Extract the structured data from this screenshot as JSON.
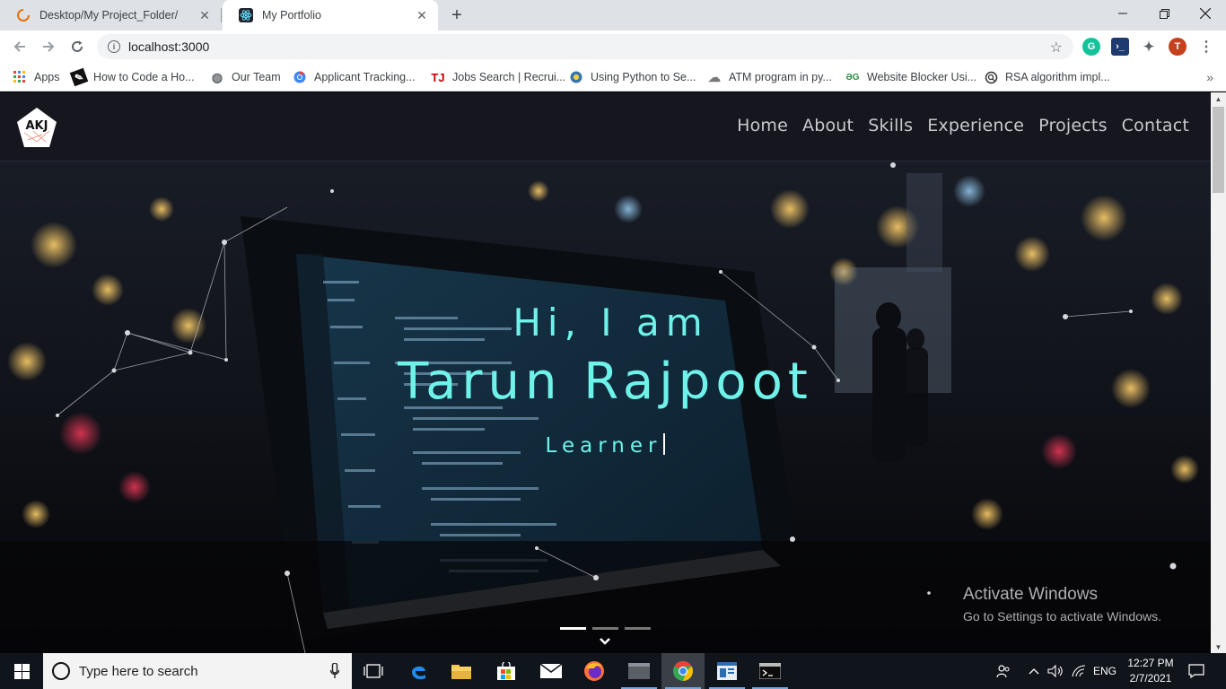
{
  "browser": {
    "tabs": [
      {
        "title": "Desktop/My Project_Folder/",
        "active": false
      },
      {
        "title": "My Portfolio",
        "active": true
      }
    ],
    "address": "localhost:3000",
    "profile_initial": "T",
    "bookmarks": [
      {
        "label": "Apps",
        "icon": "apps-grid-icon"
      },
      {
        "label": "How to Code a Ho...",
        "icon": "code-icon"
      },
      {
        "label": "Our Team",
        "icon": "globe-icon"
      },
      {
        "label": "Applicant Tracking...",
        "icon": "chrome-icon"
      },
      {
        "label": "Jobs Search | Recrui...",
        "icon": "tj-icon"
      },
      {
        "label": "Using Python to Se...",
        "icon": "python-icon"
      },
      {
        "label": "ATM program in py...",
        "icon": "cloud-icon"
      },
      {
        "label": "Website Blocker Usi...",
        "icon": "gfg-icon"
      },
      {
        "label": "RSA algorithm impl...",
        "icon": "search-globe-icon"
      }
    ],
    "more_bookmarks": "»"
  },
  "site": {
    "logo_text": "AKJ",
    "nav": [
      "Home",
      "About",
      "Skills",
      "Experience",
      "Projects",
      "Contact"
    ],
    "hero": {
      "greeting": "Hi, I am",
      "name": "Tarun Rajpoot",
      "role": "Learner"
    },
    "carousel": {
      "count": 3,
      "active_index": 0
    }
  },
  "watermark": {
    "title": "Activate Windows",
    "subtitle": "Go to Settings to activate Windows."
  },
  "taskbar": {
    "search_placeholder": "Type here to search",
    "language": "ENG",
    "time": "12:27 PM",
    "date": "2/7/2021"
  },
  "colors": {
    "accent_cyan": "#6ef2ea",
    "nav_bg": "#16161e",
    "taskbar_bg": "#10141b"
  }
}
